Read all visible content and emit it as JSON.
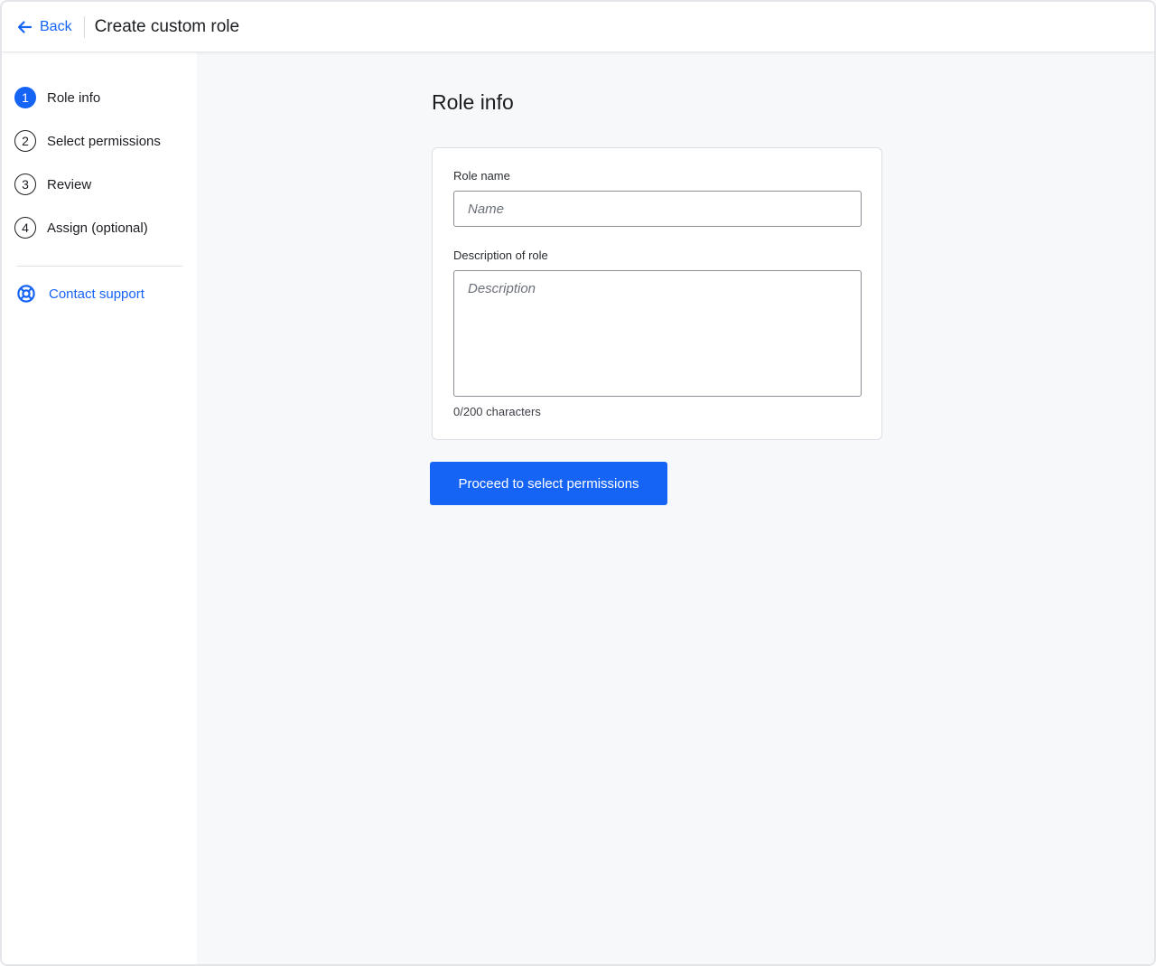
{
  "header": {
    "back_label": "Back",
    "title": "Create custom role"
  },
  "sidebar": {
    "steps": [
      {
        "number": "1",
        "label": "Role info",
        "active": true
      },
      {
        "number": "2",
        "label": "Select permissions",
        "active": false
      },
      {
        "number": "3",
        "label": "Review",
        "active": false
      },
      {
        "number": "4",
        "label": "Assign (optional)",
        "active": false
      }
    ],
    "support_label": "Contact support"
  },
  "main": {
    "section_title": "Role info",
    "role_name": {
      "label": "Role name",
      "value": "",
      "placeholder": "Name"
    },
    "description": {
      "label": "Description of role",
      "value": "",
      "placeholder": "Description"
    },
    "char_count": "0/200 characters",
    "proceed_label": "Proceed to select permissions"
  },
  "colors": {
    "accent": "#1664f5",
    "main_bg": "#f7f8fa",
    "text": "#1b1d21"
  },
  "icons": {
    "back": "arrow-left-icon",
    "support": "lifebuoy-icon"
  }
}
